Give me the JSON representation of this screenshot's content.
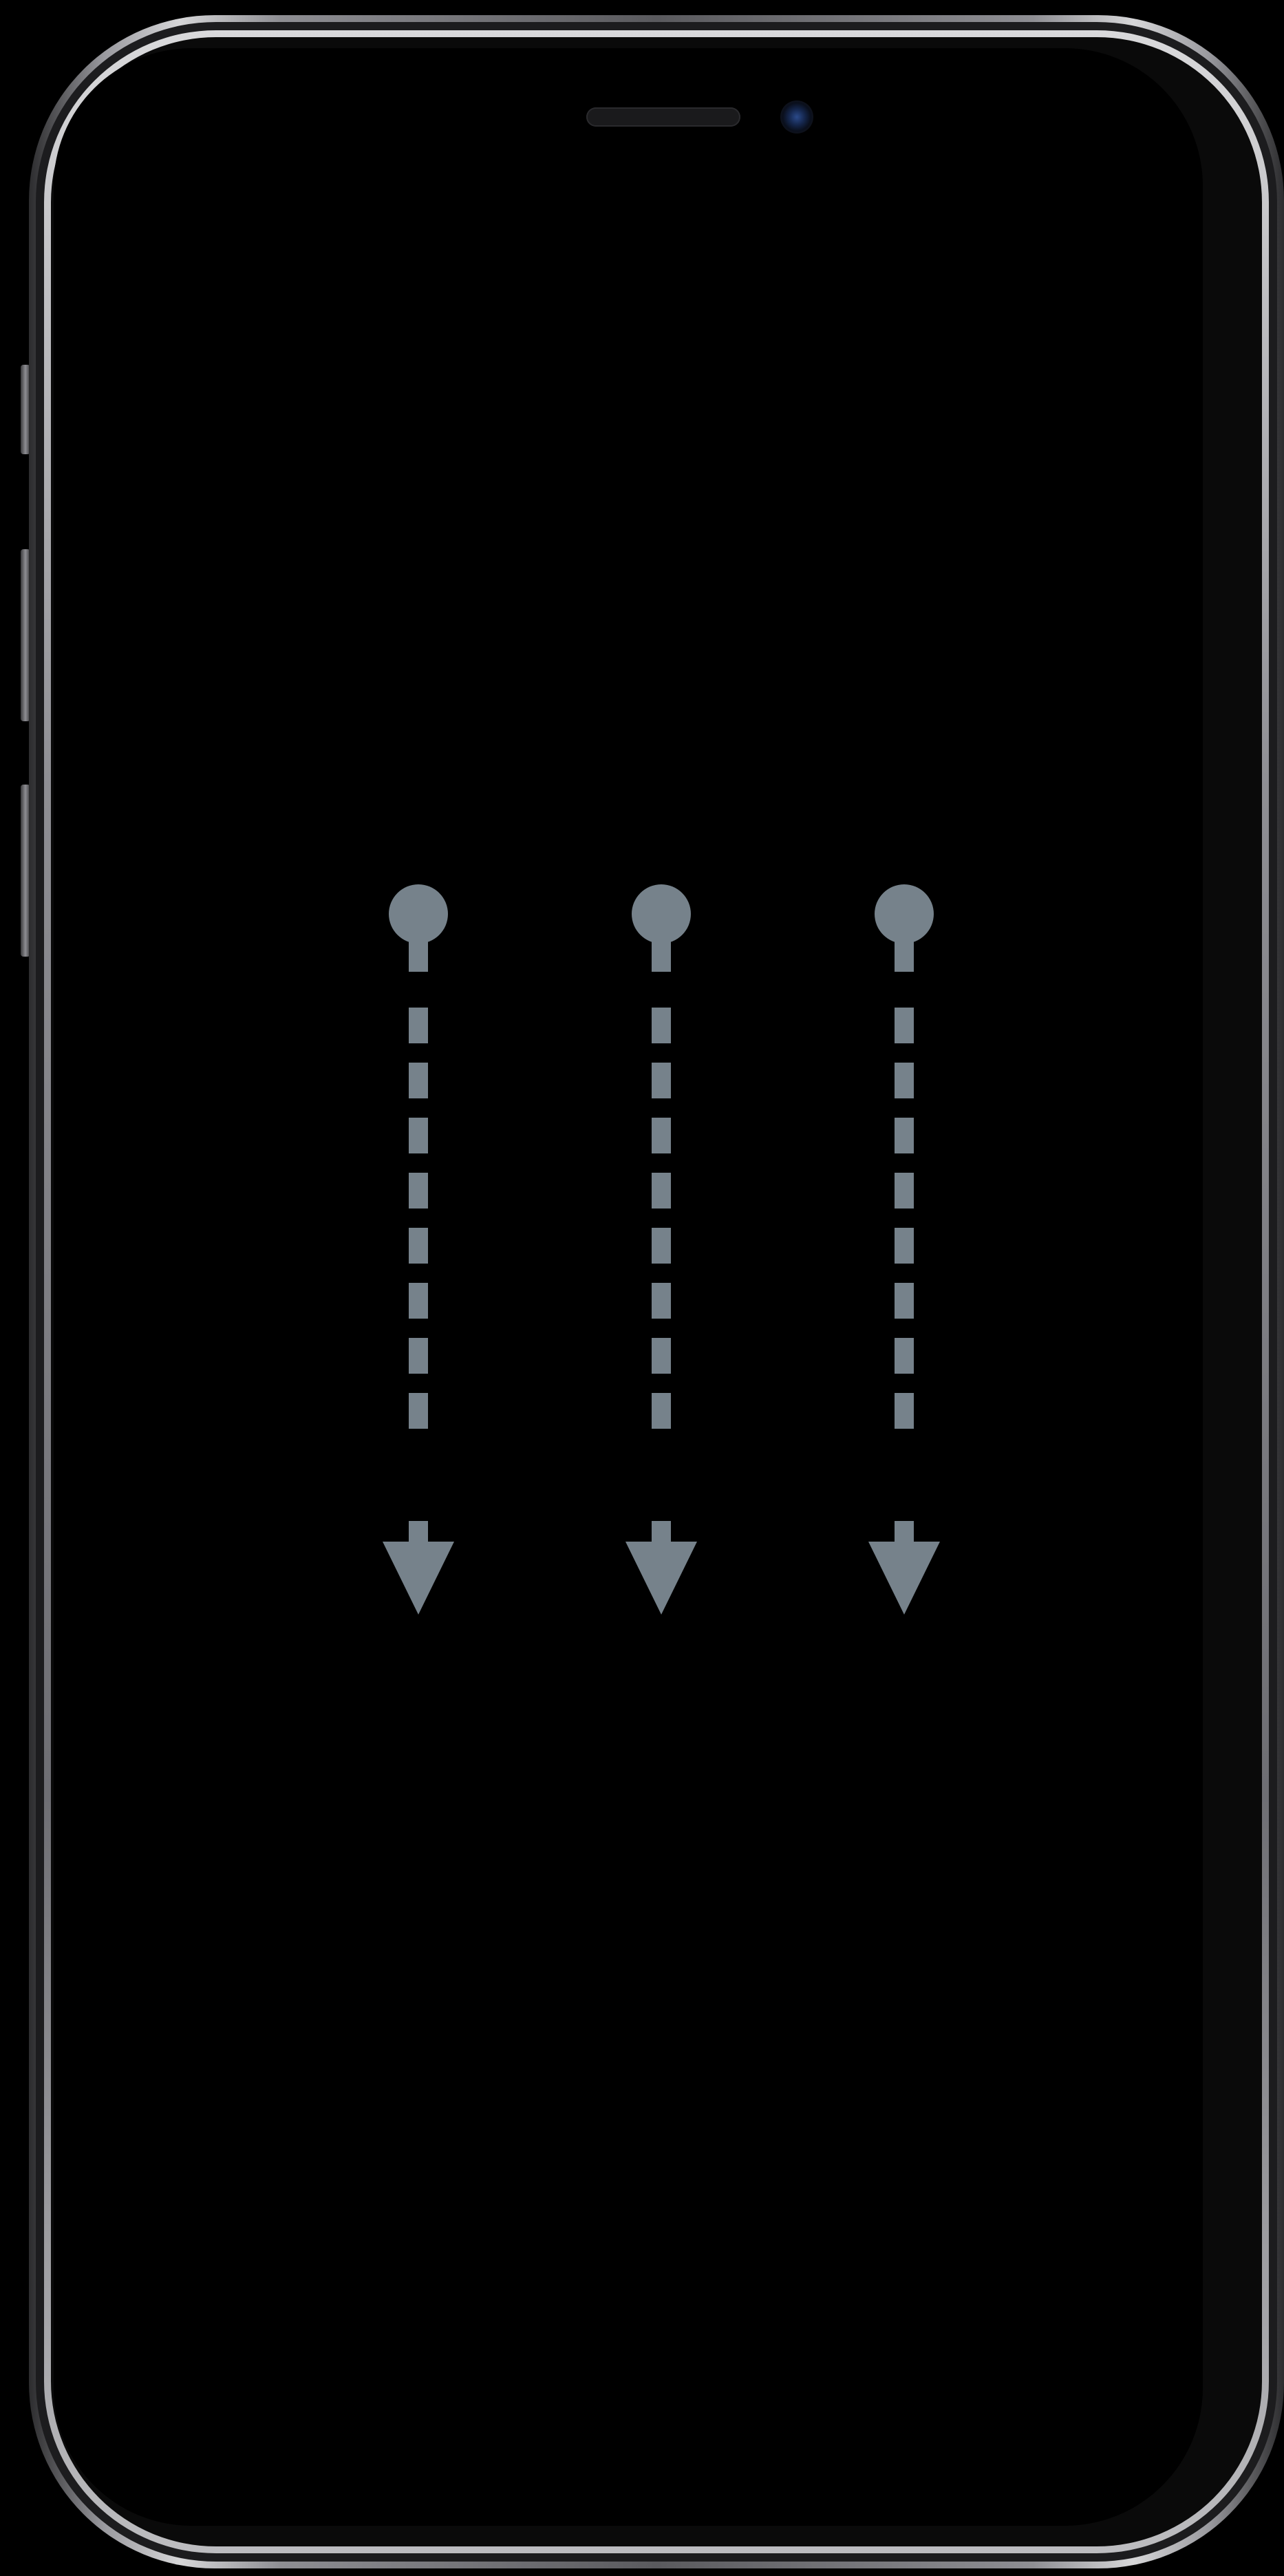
{
  "device": {
    "frame_color": "#8e8e93",
    "screen_color": "#000000"
  },
  "gesture": {
    "type": "three-finger-swipe-down",
    "finger_count": 3,
    "direction": "down",
    "color": "#76828b",
    "icons": [
      "touch-point-icon",
      "dashed-path",
      "arrow-down-icon"
    ]
  }
}
